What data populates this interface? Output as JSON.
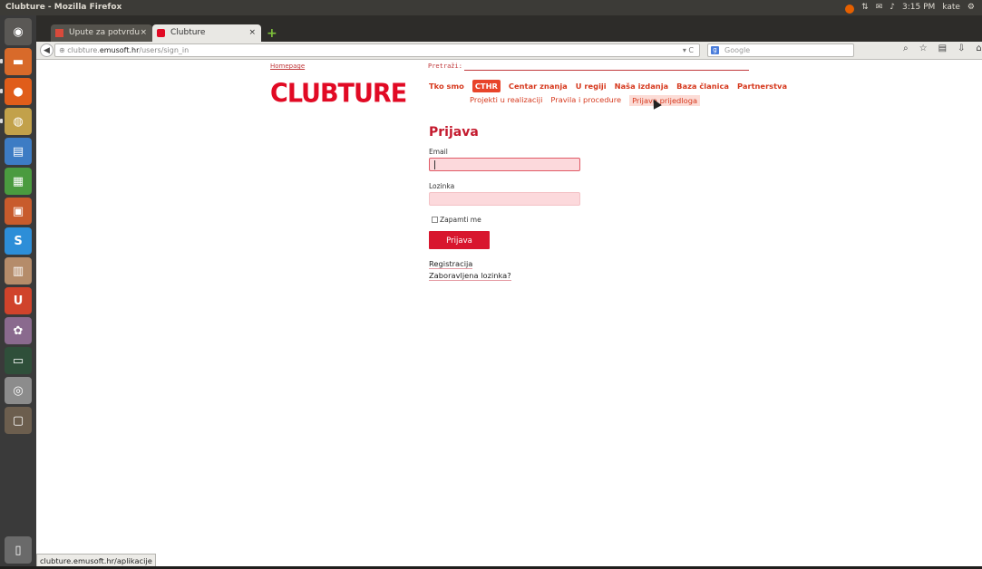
{
  "window": {
    "title": "Clubture - Mozilla Firefox"
  },
  "system_tray": {
    "time": "3:15 PM",
    "user": "kate"
  },
  "tabs": [
    {
      "label": "Upute za potvrdu ko...",
      "close": "×"
    },
    {
      "label": "Clubture",
      "close": "×"
    }
  ],
  "new_tab": "+",
  "address_bar": {
    "scheme_prefix": "clubture.",
    "host": "emusoft.hr",
    "path": "/users/sign_in",
    "reload": "▾ C"
  },
  "search_bar": {
    "placeholder": "Google",
    "engine": "g"
  },
  "page": {
    "homepage_link": "Homepage",
    "search_label": "Pretraži:",
    "logo": "CLUBTURE",
    "main_nav": [
      "Tko smo",
      "CTHR",
      "Centar znanja",
      "U regiji",
      "Naša izdanja",
      "Baza članica",
      "Partnerstva"
    ],
    "main_nav_active": "CTHR",
    "sub_nav": [
      "Projekti u realizaciji",
      "Pravila i procedure",
      "Prijava prijedloga"
    ],
    "form": {
      "heading": "Prijava",
      "email_label": "Email",
      "email_value": "",
      "password_label": "Lozinka",
      "password_value": "",
      "remember_label": "Zapamti me",
      "submit_label": "Prijava",
      "register_link": "Registracija",
      "forgot_link": "Zaboravljena lozinka?"
    }
  },
  "status_bar": {
    "text": "clubture.emusoft.hr/aplikacije"
  },
  "colors": {
    "brand_red": "#e10a24",
    "nav_orange": "#d6391e",
    "input_pink": "#fcd9dc",
    "launcher_bg": "#3a3a3a"
  }
}
